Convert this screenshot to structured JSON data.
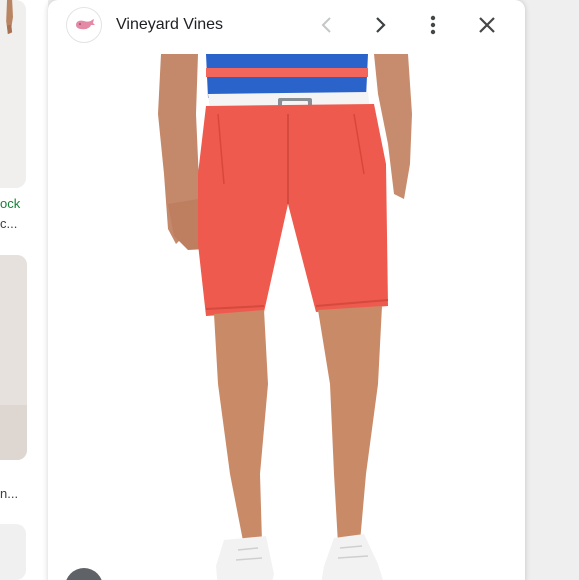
{
  "background_results": {
    "items": [
      {
        "source_fragment": "ock",
        "title_fragment": "c..."
      },
      {
        "title_fragment": "n..."
      }
    ]
  },
  "preview": {
    "site_name": "Vineyard Vines",
    "favicon_icon": "vineyard-vines-whale-icon",
    "controls": {
      "previous_icon": "chevron-left-icon",
      "next_icon": "chevron-right-icon",
      "more_icon": "more-vert-icon",
      "close_icon": "close-icon"
    },
    "image_subject": "man wearing coral red shorts, white belt, blue striped shirt",
    "colors": {
      "shorts": "#ee5a4d",
      "shirt": "#2a63c9",
      "stripe": "#f2665c",
      "belt": "#f4f4f4",
      "skin": "#c98a68",
      "source_green": "#188038"
    }
  }
}
